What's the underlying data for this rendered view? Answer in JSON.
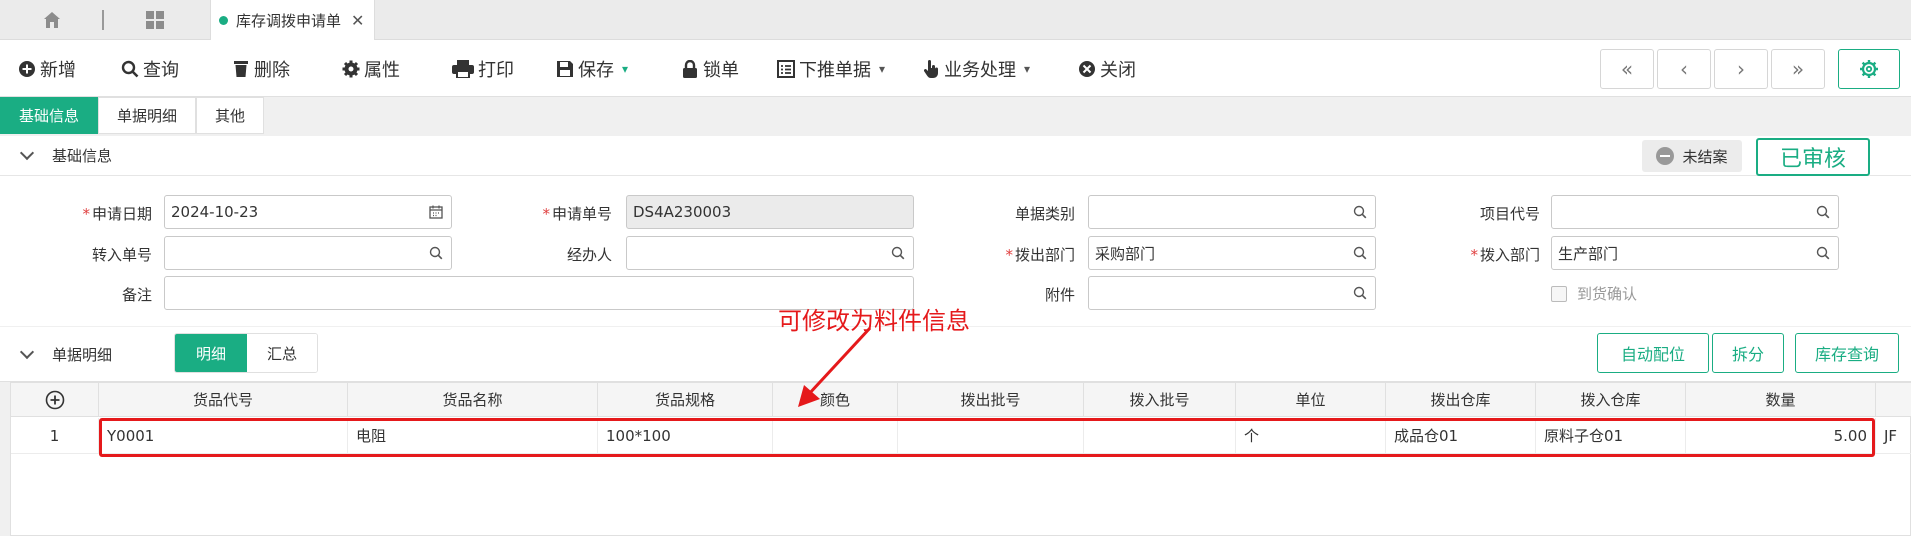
{
  "tabs": {
    "doc_tab_label": "库存调拨申请单",
    "close": "✕"
  },
  "toolbar": {
    "new": "新增",
    "query": "查询",
    "delete": "删除",
    "props": "属性",
    "print": "打印",
    "save": "保存",
    "lock": "锁单",
    "push": "下推单据",
    "business": "业务处理",
    "close": "关闭"
  },
  "nav": {
    "first": "«",
    "prev": "‹",
    "next": "›",
    "last": "»"
  },
  "section_tabs": [
    "基础信息",
    "单据明细",
    "其他"
  ],
  "basic": {
    "title": "基础信息",
    "status_badge": "未结案",
    "audit_button": "已审核",
    "labels": {
      "apply_date": "申请日期",
      "apply_no": "申请单号",
      "doc_type": "单据类别",
      "project_code": "项目代号",
      "in_no": "转入单号",
      "handler": "经办人",
      "out_dept": "拨出部门",
      "in_dept": "拨入部门",
      "remark": "备注",
      "attachment": "附件",
      "arrival_confirm": "到货确认"
    },
    "values": {
      "apply_date": "2024-10-23",
      "apply_no": "DS4A230003",
      "doc_type": "",
      "project_code": "",
      "in_no": "",
      "handler": "",
      "out_dept": "采购部门",
      "in_dept": "生产部门",
      "remark": "",
      "attachment": ""
    }
  },
  "detail": {
    "title": "单据明细",
    "toggle": [
      "明细",
      "汇总"
    ],
    "buttons": {
      "auto_alloc": "自动配位",
      "split": "拆分",
      "stock_query": "库存查询"
    },
    "columns": [
      "货品代号",
      "货品名称",
      "货品规格",
      "颜色",
      "拨出批号",
      "拨入批号",
      "单位",
      "拨出仓库",
      "拨入仓库",
      "数量"
    ],
    "rows": [
      {
        "no": "1",
        "code": "Y0001",
        "name": "电阻",
        "spec": "100*100",
        "color": "",
        "out_batch": "",
        "in_batch": "",
        "unit": "个",
        "out_wh": "成品仓01",
        "in_wh": "原料子仓01",
        "qty": "5.00",
        "extra": "JF"
      }
    ]
  },
  "annotation": {
    "text": "可修改为料件信息",
    "color": "#e5191b"
  },
  "colors": {
    "accent": "#1aad83",
    "annotation": "#e5191b"
  }
}
